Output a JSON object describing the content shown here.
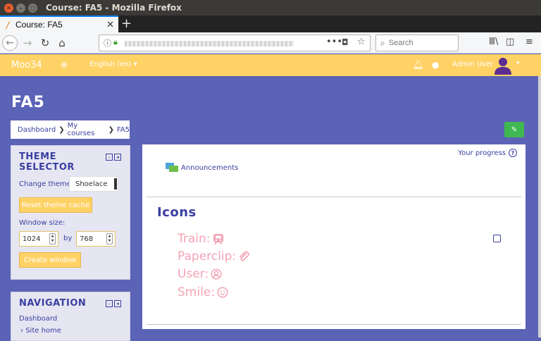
{
  "window": {
    "title": "Course: FA5 - Mozilla Firefox"
  },
  "browser": {
    "tab_title": "Course: FA5",
    "search_placeholder": "Search"
  },
  "moodle": {
    "brand": "Moo34",
    "language": "English (en) ▾",
    "user_name": "Admin User",
    "accent_color": "#ffd266",
    "primary_color": "#3a3fa0",
    "background_color": "#5b63b7"
  },
  "course": {
    "title": "FA5",
    "breadcrumb": [
      "Dashboard",
      "My courses",
      "FA5"
    ]
  },
  "theme_block": {
    "title": "THEME SELECTOR",
    "change_theme_label": "Change theme:",
    "theme_value": "Shoelace",
    "reset_button": "Reset theme cache",
    "window_size_label": "Window size:",
    "width_value": "1024",
    "by_label": "by",
    "height_value": "768",
    "create_button": "Create window"
  },
  "nav_block": {
    "title": "NAVIGATION",
    "items": [
      "Dashboard",
      "Site home"
    ]
  },
  "main": {
    "progress_label": "Your progress",
    "announcements": "Announcements",
    "section_title": "Icons",
    "icon_items": [
      {
        "label": "Train:",
        "icon": "train-icon"
      },
      {
        "label": "Paperclip:",
        "icon": "paperclip-icon"
      },
      {
        "label": "User:",
        "icon": "user-circle-icon"
      },
      {
        "label": "Smile:",
        "icon": "smile-icon"
      }
    ]
  }
}
